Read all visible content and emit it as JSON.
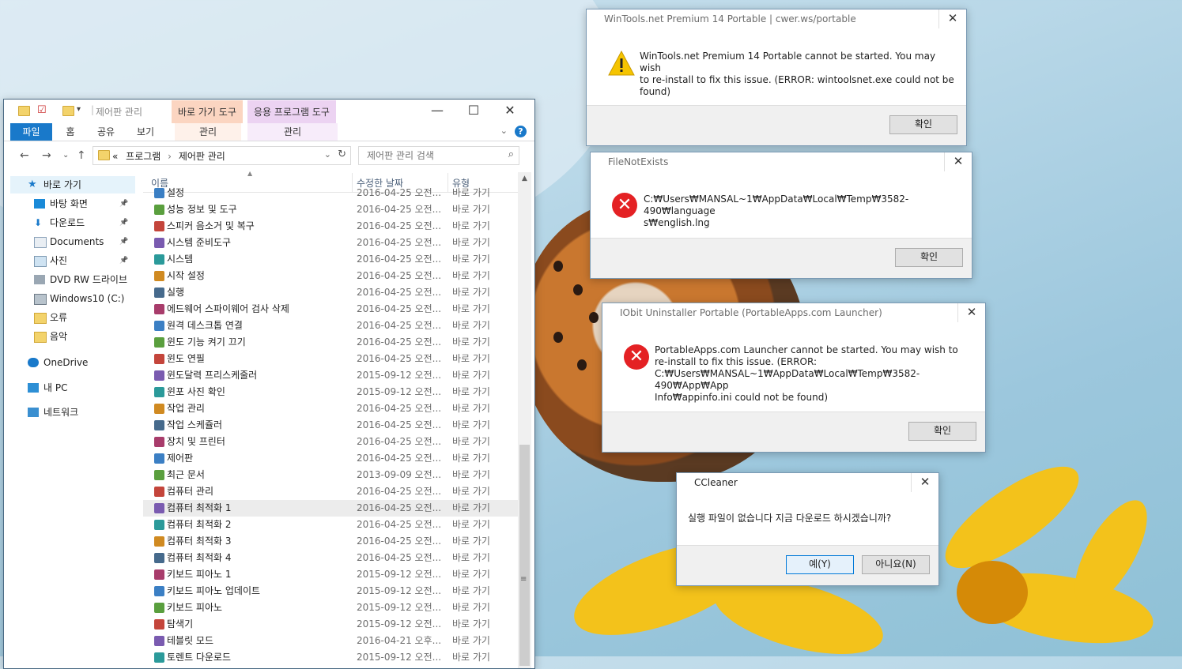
{
  "explorer": {
    "title": "제어판 관리",
    "context_tabs": [
      {
        "header": "바로 가기 도구",
        "sub": "관리",
        "color": "#fbd5c1"
      },
      {
        "header": "응용 프로그램 도구",
        "sub": "관리",
        "color": "#ecd3f2"
      }
    ],
    "ribbon_tabs": [
      "파일",
      "홈",
      "공유",
      "보기"
    ],
    "address": {
      "prefix": "«",
      "segments": [
        "프로그램",
        "제어판 관리"
      ]
    },
    "search_placeholder": "제어판 관리 검색",
    "columns": {
      "name": "이름",
      "date": "수정한 날짜",
      "type": "유형"
    },
    "nav": [
      {
        "label": "바로 가기",
        "icon": "star-icon"
      },
      {
        "label": "바탕 화면",
        "icon": "desktop-icon",
        "pinned": true
      },
      {
        "label": "다운로드",
        "icon": "download-icon",
        "pinned": true
      },
      {
        "label": "Documents",
        "icon": "documents-icon",
        "pinned": true
      },
      {
        "label": "사진",
        "icon": "pictures-icon",
        "pinned": true
      },
      {
        "label": "DVD RW 드라이브",
        "icon": "dvd-drive-icon"
      },
      {
        "label": "Windows10 (C:)",
        "icon": "disk-drive-icon"
      },
      {
        "label": "오류",
        "icon": "folder-icon"
      },
      {
        "label": "음악",
        "icon": "folder-icon"
      },
      {
        "label": "OneDrive",
        "icon": "onedrive-icon"
      },
      {
        "label": "내 PC",
        "icon": "pc-icon"
      },
      {
        "label": "네트워크",
        "icon": "network-icon"
      }
    ],
    "files": [
      {
        "name": "설정",
        "date": "2016-04-25 오전...",
        "type": "바로 가기"
      },
      {
        "name": "성능 정보 및 도구",
        "date": "2016-04-25 오전...",
        "type": "바로 가기"
      },
      {
        "name": "스피커 음소거 및 복구",
        "date": "2016-04-25 오전...",
        "type": "바로 가기"
      },
      {
        "name": "시스템 준비도구",
        "date": "2016-04-25 오전...",
        "type": "바로 가기"
      },
      {
        "name": "시스템",
        "date": "2016-04-25 오전...",
        "type": "바로 가기"
      },
      {
        "name": "시작 설정",
        "date": "2016-04-25 오전...",
        "type": "바로 가기"
      },
      {
        "name": "실행",
        "date": "2016-04-25 오전...",
        "type": "바로 가기"
      },
      {
        "name": "에드웨어 스파이웨어 검사 삭제",
        "date": "2016-04-25 오전...",
        "type": "바로 가기"
      },
      {
        "name": "원격 데스크톱 연결",
        "date": "2016-04-25 오전...",
        "type": "바로 가기"
      },
      {
        "name": "윈도 기능 켜기 끄기",
        "date": "2016-04-25 오전...",
        "type": "바로 가기"
      },
      {
        "name": "윈도 연필",
        "date": "2016-04-25 오전...",
        "type": "바로 가기"
      },
      {
        "name": "윈도달력 프리스케줄러",
        "date": "2015-09-12 오전...",
        "type": "바로 가기"
      },
      {
        "name": "윈포 사진 확인",
        "date": "2015-09-12 오전...",
        "type": "바로 가기"
      },
      {
        "name": "작업 관리",
        "date": "2016-04-25 오전...",
        "type": "바로 가기"
      },
      {
        "name": "작업 스케쥴러",
        "date": "2016-04-25 오전...",
        "type": "바로 가기"
      },
      {
        "name": "장치 및 프린터",
        "date": "2016-04-25 오전...",
        "type": "바로 가기"
      },
      {
        "name": "제어판",
        "date": "2016-04-25 오전...",
        "type": "바로 가기"
      },
      {
        "name": "최근 문서",
        "date": "2013-09-09 오전...",
        "type": "바로 가기"
      },
      {
        "name": "컴퓨터 관리",
        "date": "2016-04-25 오전...",
        "type": "바로 가기"
      },
      {
        "name": "컴퓨터 최적화 1",
        "date": "2016-04-25 오전...",
        "type": "바로 가기"
      },
      {
        "name": "컴퓨터 최적화 2",
        "date": "2016-04-25 오전...",
        "type": "바로 가기"
      },
      {
        "name": "컴퓨터 최적화 3",
        "date": "2016-04-25 오전...",
        "type": "바로 가기"
      },
      {
        "name": "컴퓨터 최적화 4",
        "date": "2016-04-25 오전...",
        "type": "바로 가기"
      },
      {
        "name": "키보드 피아노 1",
        "date": "2015-09-12 오전...",
        "type": "바로 가기"
      },
      {
        "name": "키보드 피아노 업데이트",
        "date": "2015-09-12 오전...",
        "type": "바로 가기"
      },
      {
        "name": "키보드 피아노",
        "date": "2015-09-12 오전...",
        "type": "바로 가기"
      },
      {
        "name": "탐색기",
        "date": "2015-09-12 오전...",
        "type": "바로 가기"
      },
      {
        "name": "테블릿 모드",
        "date": "2016-04-21 오후...",
        "type": "바로 가기"
      },
      {
        "name": "토렌트 다운로드",
        "date": "2015-09-12 오전...",
        "type": "바로 가기"
      }
    ],
    "highlighted_file": "컴퓨터 최적화 1"
  },
  "dialogs": {
    "wintools": {
      "title": "WinTools.net Premium 14 Portable | cwer.ws/portable",
      "message": "WinTools.net Premium 14 Portable cannot be started. You may wish\nto re-install to fix this issue. (ERROR: wintoolsnet.exe could not be\nfound)",
      "ok": "확인",
      "icon": "warning-icon"
    },
    "filenotexists": {
      "title": "FileNotExists",
      "message": "C:₩Users₩MANSAL~1₩AppData₩Local₩Temp₩3582-490₩language\ns₩english.lng",
      "ok": "확인",
      "icon": "error-icon"
    },
    "iobit": {
      "title": "IObit Uninstaller Portable (PortableApps.com Launcher)",
      "message": "PortableApps.com Launcher cannot be started. You may wish to\nre-install to fix this issue. (ERROR:\nC:₩Users₩MANSAL~1₩AppData₩Local₩Temp₩3582-490₩App₩App\nInfo₩appinfo.ini could not be found)",
      "ok": "확인",
      "icon": "error-icon"
    },
    "ccleaner": {
      "title": "CCleaner",
      "message": "실행 파일이 없습니다 지금 다운로드 하시겠습니까?",
      "yes": "예(Y)",
      "no": "아니요(N)"
    }
  },
  "colors": {
    "accent": "#1979ca",
    "error": "#e42124",
    "warning": "#f5c400"
  }
}
